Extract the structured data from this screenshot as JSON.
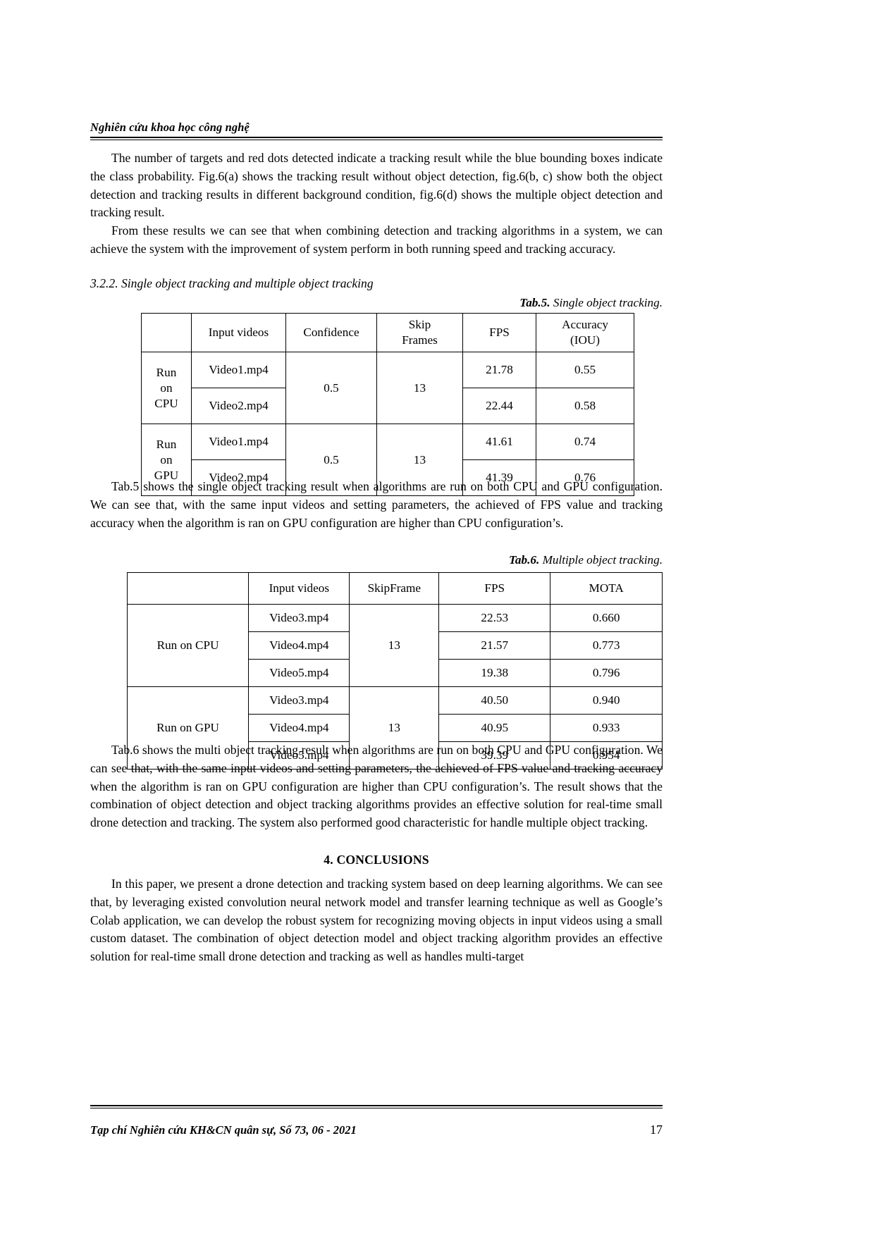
{
  "running_head": "Nghiên cứu khoa học công nghệ",
  "paragraphs": {
    "p1": "The number of targets and red dots detected indicate a tracking result while the blue bounding boxes indicate the class probability. Fig.6(a) shows the tracking result without object detection, fig.6(b, c) show both the object detection and tracking results in different background condition, fig.6(d) shows the multiple object detection and tracking result.",
    "p2": "From these results we can see that when combining detection and tracking algorithms in a system, we can achieve the system with the improvement of system perform in both running speed and tracking accuracy.",
    "section_heading": "3.2.2. Single object tracking and multiple object tracking",
    "p3": "Tab.5 shows the single object tracking result when algorithms are run on both CPU and GPU configuration. We can see that, with the same input videos and setting parameters, the achieved of FPS value and tracking accuracy when the algorithm is ran on GPU configuration are higher than CPU configuration’s.",
    "p4": "Tab.6 shows the multi object tracking result when algorithms are run on both CPU and GPU configuration. We can see that, with the same input videos and setting parameters, the achieved of FPS value and tracking accuracy when the algorithm is ran on GPU configuration are higher than CPU configuration’s. The result shows that the combination of object detection and object tracking algorithms provides an effective solution for real-time small drone detection and tracking. The system also performed good characteristic for handle multiple object tracking.",
    "conclusions_heading": "4. CONCLUSIONS",
    "p5": "In this paper, we present a drone detection and tracking system based on deep learning algorithms. We can see that, by leveraging existed convolution neural network model and transfer learning technique as well as Google’s Colab application, we can develop the robust system for recognizing moving objects in input videos using a small custom dataset. The combination of object detection model and object tracking algorithm provides an effective solution for real-time small drone detection and tracking as well as handles multi-target"
  },
  "table5": {
    "caption_label": "Tab.5.",
    "caption_text": " Single object tracking.",
    "headers": [
      "",
      "Input videos",
      "Confidence",
      "Skip Frames",
      "FPS",
      "Accuracy (IOU)"
    ],
    "header_skip_line1": "Skip",
    "header_skip_line2": "Frames",
    "header_acc_line1": "Accuracy",
    "header_acc_line2": "(IOU)",
    "groups": [
      {
        "label_line1": "Run",
        "label_line2": "on",
        "label_line3": "CPU",
        "confidence": "0.5",
        "skip_frames": "13",
        "rows": [
          {
            "video": "Video1.mp4",
            "fps": "21.78",
            "accuracy": "0.55"
          },
          {
            "video": "Video2.mp4",
            "fps": "22.44",
            "accuracy": "0.58"
          }
        ]
      },
      {
        "label_line1": "Run",
        "label_line2": "on",
        "label_line3": "GPU",
        "confidence": "0.5",
        "skip_frames": "13",
        "rows": [
          {
            "video": "Video1.mp4",
            "fps": "41.61",
            "accuracy": "0.74"
          },
          {
            "video": "Video2.mp4",
            "fps": "41.39",
            "accuracy": "0.76"
          }
        ]
      }
    ]
  },
  "table6": {
    "caption_label": "Tab.6.",
    "caption_text": " Multiple object tracking.",
    "headers": [
      "",
      "Input videos",
      "SkipFrame",
      "FPS",
      "MOTA"
    ],
    "groups": [
      {
        "label": "Run on CPU",
        "skip_frame": "13",
        "rows": [
          {
            "video": "Video3.mp4",
            "fps": "22.53",
            "mota": "0.660"
          },
          {
            "video": "Video4.mp4",
            "fps": "21.57",
            "mota": "0.773"
          },
          {
            "video": "Video5.mp4",
            "fps": "19.38",
            "mota": "0.796"
          }
        ]
      },
      {
        "label": "Run on GPU",
        "skip_frame": "13",
        "rows": [
          {
            "video": "Video3.mp4",
            "fps": "40.50",
            "mota": "0.940"
          },
          {
            "video": "Video4.mp4",
            "fps": "40.95",
            "mota": "0.933"
          },
          {
            "video": "Video5.mp4",
            "fps": "39.39",
            "mota": "0.954"
          }
        ]
      }
    ]
  },
  "footer": {
    "journal_line": "Tạp chí Nghiên cứu KH&CN quân sự, Số 73, 06 - 2021",
    "page_number": "17"
  }
}
